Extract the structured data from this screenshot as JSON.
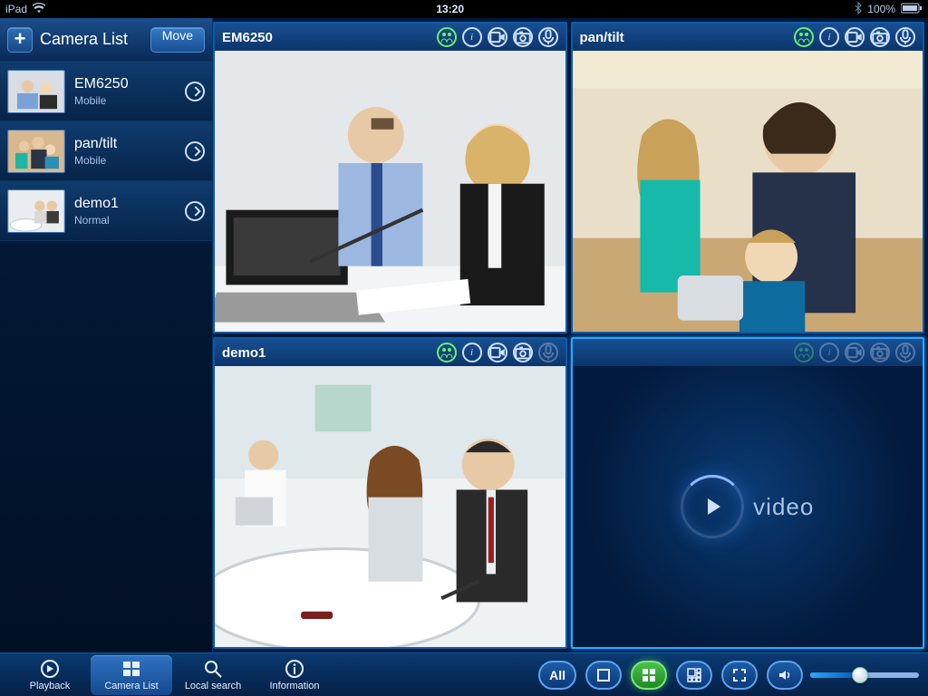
{
  "status_bar": {
    "device": "iPad",
    "time": "13:20",
    "battery": "100%"
  },
  "sidebar": {
    "title": "Camera List",
    "move_label": "Move",
    "items": [
      {
        "name": "EM6250",
        "sub": "Mobile"
      },
      {
        "name": "pan/tilt",
        "sub": "Mobile"
      },
      {
        "name": "demo1",
        "sub": "Normal"
      }
    ]
  },
  "feeds": [
    {
      "title": "EM6250",
      "active": true,
      "scene": "office"
    },
    {
      "title": "pan/tilt",
      "active": true,
      "scene": "family"
    },
    {
      "title": "demo1",
      "active": true,
      "scene": "meeting"
    },
    {
      "title": "",
      "active": false,
      "scene": ""
    }
  ],
  "placeholder_label": "video",
  "bottom": {
    "nav": [
      {
        "label": "Playback",
        "icon": "playback"
      },
      {
        "label": "Camera List",
        "icon": "cameralist",
        "active": true
      },
      {
        "label": "Local search",
        "icon": "search"
      },
      {
        "label": "Information",
        "icon": "info"
      }
    ],
    "all_label": "All"
  }
}
